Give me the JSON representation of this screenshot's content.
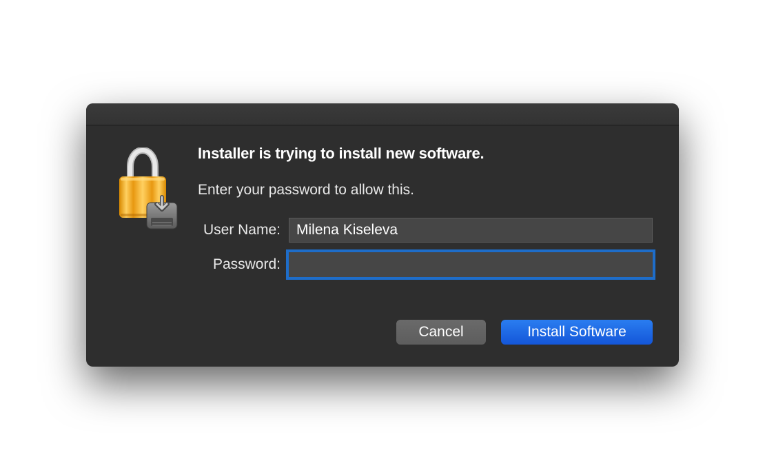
{
  "dialog": {
    "title": "Installer is trying to install new software.",
    "subtitle": "Enter your password to allow this.",
    "username_label": "User Name:",
    "username_value": "Milena Kiseleva",
    "password_label": "Password:",
    "password_value": "",
    "cancel_label": "Cancel",
    "submit_label": "Install Software"
  }
}
